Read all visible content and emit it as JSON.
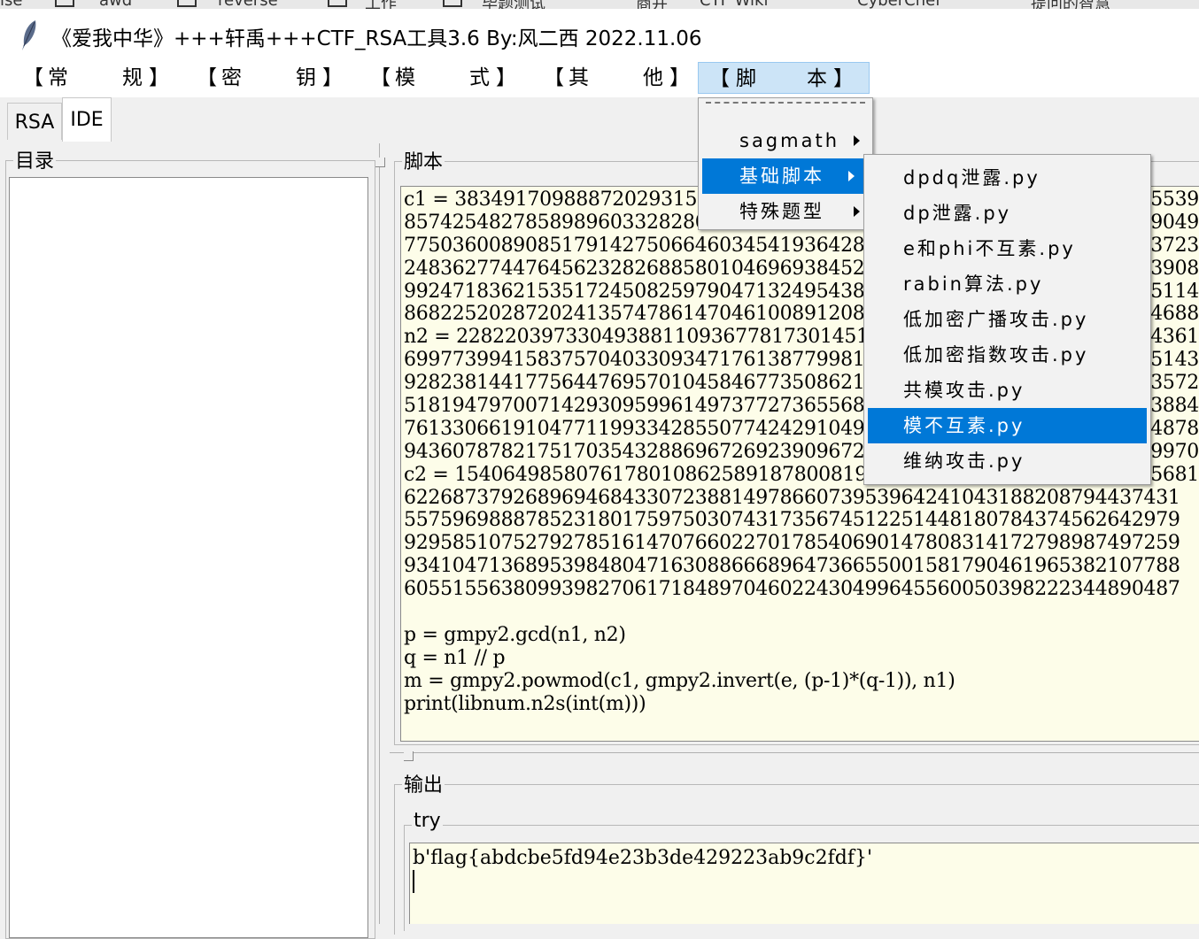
{
  "browser_bookmarks": [
    "ise",
    "awd",
    "reverse",
    "工作",
    "毕题测试",
    "商并",
    "CTF Wiki",
    "CyberChef",
    "提问的智慧"
  ],
  "window": {
    "title": "《爱我中华》+++轩禹+++CTF_RSA工具3.6   By:风二西 2022.11.06"
  },
  "menubar": [
    {
      "c1": "常",
      "c2": "规"
    },
    {
      "c1": "密",
      "c2": "钥"
    },
    {
      "c1": "模",
      "c2": "式"
    },
    {
      "c1": "其",
      "c2": "他"
    },
    {
      "c1": "脚",
      "c2": "本"
    }
  ],
  "tabs": [
    "RSA",
    "IDE"
  ],
  "panels": {
    "directory_label": "目录",
    "script_label": "脚本",
    "output_label": "输出",
    "try_label": "try"
  },
  "script_lines": [
    "c1 = 38349170988872029315",
    "85742548278589896033282806",
    "77503600890851791427506646034541936428",
    "24836277447645623282688580104696938452",
    "99247183621535172450825979047132495438",
    "86822520287202413574786147046100891208",
    "n2 = 2282203973304938811093677817301451",
    "69977399415837570403309347176138779981",
    "92823814417756447695701045846773508621",
    "51819479700714293095996149737727365568",
    "76133066191047711993342855077424291049",
    "94360787821751703543288696726923909672",
    "c2 = 1540649858076178010862589187800819",
    "6226873792689694684330723881497866073953964241043188208794437431",
    "5575969888785231801759750307431735674512251448180784374562642979",
    "9295851075279278516147076602270178540690147808314172798987497259",
    "9341047136895398480471630886668964736655001581790461965382107788",
    "6055155638099398270617184897046022430499645560050398222344890487",
    "",
    "p = gmpy2.gcd(n1, n2)",
    "q = n1 // p",
    "m = gmpy2.powmod(c1, gmpy2.invert(e, (p-1)*(q-1)), n1)",
    "print(libnum.n2s(int(m)))"
  ],
  "script_right_tails": [
    "5539",
    "9049",
    "3723",
    "3908",
    "5114",
    "4688",
    "4361",
    "5143",
    "3572",
    "3884",
    "4878",
    "9970",
    "5681"
  ],
  "output_text": "b'flag{abdcbe5fd94e23b3de429223ab9c2fdf}'",
  "script_menu": {
    "tearoff": "- - - - - - - - -",
    "items": [
      {
        "label": "sagmath",
        "has_submenu": true,
        "selected": false
      },
      {
        "label": "基础脚本",
        "has_submenu": true,
        "selected": true
      },
      {
        "label": "特殊题型",
        "has_submenu": true,
        "selected": false
      }
    ]
  },
  "basic_script_submenu": [
    {
      "label": "dpdq泄露.py",
      "selected": false
    },
    {
      "label": "dp泄露.py",
      "selected": false
    },
    {
      "label": "e和phi不互素.py",
      "selected": false
    },
    {
      "label": "rabin算法.py",
      "selected": false
    },
    {
      "label": "低加密广播攻击.py",
      "selected": false
    },
    {
      "label": "低加密指数攻击.py",
      "selected": false
    },
    {
      "label": "共模攻击.py",
      "selected": false
    },
    {
      "label": "模不互素.py",
      "selected": true
    },
    {
      "label": "维纳攻击.py",
      "selected": false
    }
  ],
  "colors": {
    "selection": "#0078d7",
    "menu_active": "#cce4f7",
    "editor_bg": "#fdfde9"
  }
}
